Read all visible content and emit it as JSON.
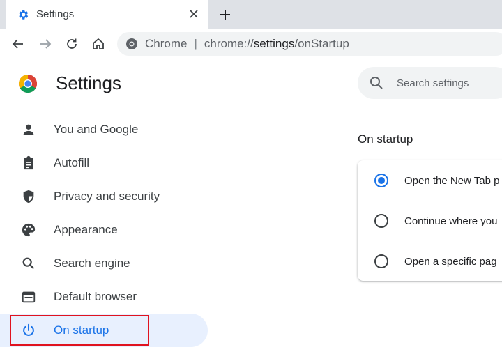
{
  "tab": {
    "title": "Settings",
    "close_icon": "close-icon",
    "new_tab_icon": "plus-icon"
  },
  "toolbar": {
    "site_name": "Chrome",
    "separator": "|",
    "url_scheme": "chrome://",
    "url_host": "settings",
    "url_path": "/onStartup"
  },
  "header": {
    "title": "Settings",
    "search_placeholder": "Search settings"
  },
  "sidebar": {
    "items": [
      {
        "label": "You and Google",
        "icon": "person-icon"
      },
      {
        "label": "Autofill",
        "icon": "clipboard-icon"
      },
      {
        "label": "Privacy and security",
        "icon": "shield-icon"
      },
      {
        "label": "Appearance",
        "icon": "palette-icon"
      },
      {
        "label": "Search engine",
        "icon": "search-icon"
      },
      {
        "label": "Default browser",
        "icon": "browser-window-icon"
      },
      {
        "label": "On startup",
        "icon": "power-icon",
        "active": true
      }
    ]
  },
  "main": {
    "section_title": "On startup",
    "options": [
      {
        "label": "Open the New Tab p",
        "checked": true
      },
      {
        "label": "Continue where you",
        "checked": false
      },
      {
        "label": "Open a specific pag",
        "checked": false
      }
    ]
  },
  "colors": {
    "accent": "#1a73e8",
    "active_bg": "#e8f0fe",
    "highlight": "#e0131f"
  }
}
